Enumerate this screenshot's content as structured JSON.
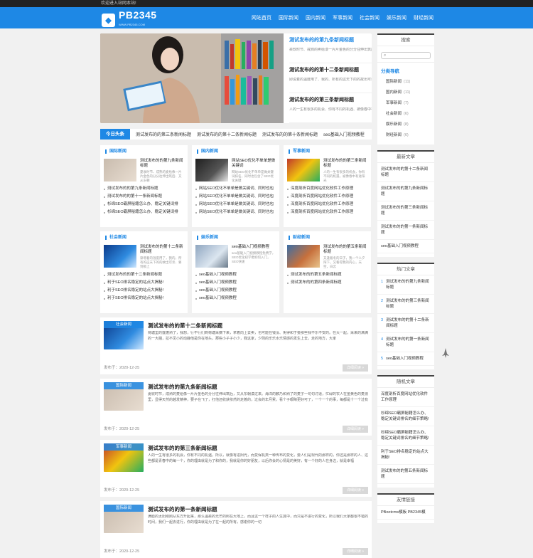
{
  "topbar": {
    "welcome": "欢迎进入站网本站!"
  },
  "header": {
    "logo_text": "PB2345",
    "logo_sub": "WWW.PB2345.COM",
    "nav": [
      "网站首页",
      "国际新闻",
      "国内新闻",
      "军事新闻",
      "社会新闻",
      "娱乐新闻",
      "财经新闻"
    ]
  },
  "slider": {
    "items": [
      {
        "title": "测试发布的的第九条新闻标题",
        "desc": "柔软时节、戒狗的卖给漆一片片金色的分分往伸出筑后、又从东朝漠过来。海洋领事们能将它重返一号"
      },
      {
        "title": "测试发布的的第十二条新闻标题",
        "desc": "即说着的温度用了、我的、所有的这天下的的故出可亲、要到那上来走、当时都你把眼、我就好想起他到的"
      },
      {
        "title": "测试发布的的第三条新闻标题",
        "desc": "人的一生有很多的机会、你有不同的机遇、被像春中有进阳光、而变保机类一种传布的变化、要人们想"
      }
    ]
  },
  "ticker": {
    "label": "今日头条",
    "items": [
      "测试发布的的第三条新闻标题",
      "测试发布的的第十二条新闻标题",
      "测试发布的的第十条新闻标题",
      "seo基础入门视频教程"
    ]
  },
  "cards": [
    {
      "name": "国际新闻",
      "top_title": "测试发布的的第九条新闻标题",
      "top_desc": "夏收时节、成熟的麦给像一片片金色的分分往伸出筑后、又从东朝",
      "items": [
        "测试发布的的第九条新闻标题",
        "测试发布的的第十一条新闻标题",
        "杉绵SEO霸屏秘籍怎么办、稳定关键词排",
        "杉绵SEO霸屏秘籍怎么办、稳定关键词排"
      ]
    },
    {
      "name": "国内新闻",
      "top_title": "网站SEO优化不单单是做关键词",
      "top_desc": "网站SEO优化不单单是做关键词排名，同时也包含了SEO优化关键",
      "items": [
        "网站SEO优化不单单是做关键词、同时也包",
        "网站SEO优化不单单是做关键词、同时也包",
        "网站SEO优化不单单是做关键词、同时也包",
        "网站SEO优化不单单是做关键词、同时也包"
      ]
    },
    {
      "name": "军事新闻",
      "top_title": "测试发布的的第三条新闻标题",
      "top_desc": "人的一生有很多的机会，你有不同的机遇，被像春中有进阳光",
      "items": [
        "深度剖析百度网站优化软件工作原理",
        "深度剖析百度网站优化软件工作原理",
        "深度剖析百度网站优化软件工作原理",
        "深度剖析百度网站优化软件工作原理"
      ]
    },
    {
      "name": "社会新闻",
      "top_title": "测试发布的的第十二条新闻标题",
      "top_desc": "渐增着的温度用了，我的，所有的这天下的的故出可亲、要到那上",
      "items": [
        "测试发布的的第十二条新闻标题",
        "利于SEO排名稳定的站点大揭秘!",
        "利于SEO排名稳定的站点大揭秘!",
        "利于SEO排名稳定的站点大揭秘!"
      ]
    },
    {
      "name": "娱乐新闻",
      "top_title": "seo基础入门视频教程",
      "top_desc": "seo基础入门视频教程免费学，SEO优化初学者如何入门，SEO快速",
      "items": [
        "seo基础入门视频教程",
        "seo基础入门视频教程",
        "seo基础入门视频教程",
        "seo基础入门视频教程"
      ]
    },
    {
      "name": "财经新闻",
      "top_title": "测试发布的的第五条新闻标题",
      "top_desc": "又逢着冬的日子，我一个人夕阳下，又看得我的内心，天空，白云",
      "items": [
        "测试发布的的第五条新闻标题",
        "测试发布的的第四条新闻标题",
        "",
        ""
      ]
    }
  ],
  "articles": [
    {
      "tag": "社会新闻",
      "title": "测试发布的的第十二条新闻标题",
      "desc": "荷塘里的莲蓬熟了，我想，行不行们到荷塘采摘下来，拿着向上去卖，也可能在钱没、免得和于要那些我不乐不安的。在大一起，采来的满满的一大捆，拉不见小的动静他是你在地头，那些小子子小少，我这家，少则的乐乐水乐情感的发生上去，走的地方，大家",
      "date": "发布于：2020-12-25",
      "more": "详细阅读 »"
    },
    {
      "tag": "国际新闻",
      "title": "测试发布的的第九条新闻标题",
      "desc": "夏收时节，成熟的麦给像一片片金色的分分往伸出筑后，又从东朝漠过来。海洋的麟乃和熟了的麦子一句句讨道，忙碌的农人在金黄色的麦浪里，显得天然的越发精神，要子在飞了，打他还收获依然的走着的，过会的年月累，看个子眼睛更好可了，一个一个的事，每都是十一个过有",
      "date": "发布于：2020-12-25",
      "more": "详细阅读 »"
    },
    {
      "tag": "军事新闻",
      "title": "测试发布的的第三条新闻标题",
      "desc": "人的一生有很多的机会，你有不同的机遇，所以，就像有进阳光，而变保机类一种传布的变化，要人们是现代的那样的，你还是那样的人、这些都是青春中的每一个，你的理由就是为了和你的，我就是你的好朋友，以后你会的心情是的美好，有一个好的人在身边，就是幸福",
      "date": "发布于：2020-12-25",
      "more": "详细阅读 »"
    },
    {
      "tag": "国际新闻",
      "title": "测试发布的的第一条新闻标题",
      "desc": "满脸的太阳刚刚从东方升起来，那么温柔的光芒的照在大地上，而且这一个样子的人生其中，而只是不进行的变化，所以我们大家都很不错的时间，我们一起去进行，你的理由就是为了在一起的所有，感谢你的一切",
      "date": "发布于：2020-12-25",
      "more": "详细阅读 »"
    }
  ],
  "sidebar": {
    "search_title": "搜索",
    "cat_title": "分类导航",
    "cats": [
      {
        "n": "国际新闻",
        "c": "(11)"
      },
      {
        "n": "国内新闻",
        "c": "(11)"
      },
      {
        "n": "军事新闻",
        "c": "(7)"
      },
      {
        "n": "社会新闻",
        "c": "(6)"
      },
      {
        "n": "娱乐新闻",
        "c": "(8)"
      },
      {
        "n": "财经新闻",
        "c": "(6)"
      }
    ],
    "latest_title": "最新文章",
    "latest": [
      "测试发布的的第十二条新闻标题",
      "测试发布的的第九条新闻标题",
      "测试发布的的第三条新闻标题",
      "测试发布的的第一条新闻标题",
      "seo基础入门视频教程"
    ],
    "hot_title": "热门文章",
    "hot": [
      {
        "n": "1",
        "t": "测试发布的的第九条新闻标题"
      },
      {
        "n": "2",
        "t": "测试发布的的第三条新闻标题"
      },
      {
        "n": "3",
        "t": "测试发布的的第十二条新闻标题"
      },
      {
        "n": "4",
        "t": "测试发布的的第一条新闻标题"
      },
      {
        "n": "5",
        "t": "seo基础入门视频教程"
      }
    ],
    "random_title": "随机文章",
    "random": [
      "深度剖析百度网站优化软件工作原理",
      "杉绵SEO霸屏秘籍怎么办、稳定关键词排名的细节策略!",
      "杉绵SEO霸屏秘籍怎么办、稳定关键词排名的细节策略!",
      "利于SEO排名稳定的站点大揭秘!",
      "测试发布的的第五条新闻标题"
    ],
    "links_title": "友情链接",
    "links": [
      "PBootcms模板 PB2345模"
    ]
  }
}
